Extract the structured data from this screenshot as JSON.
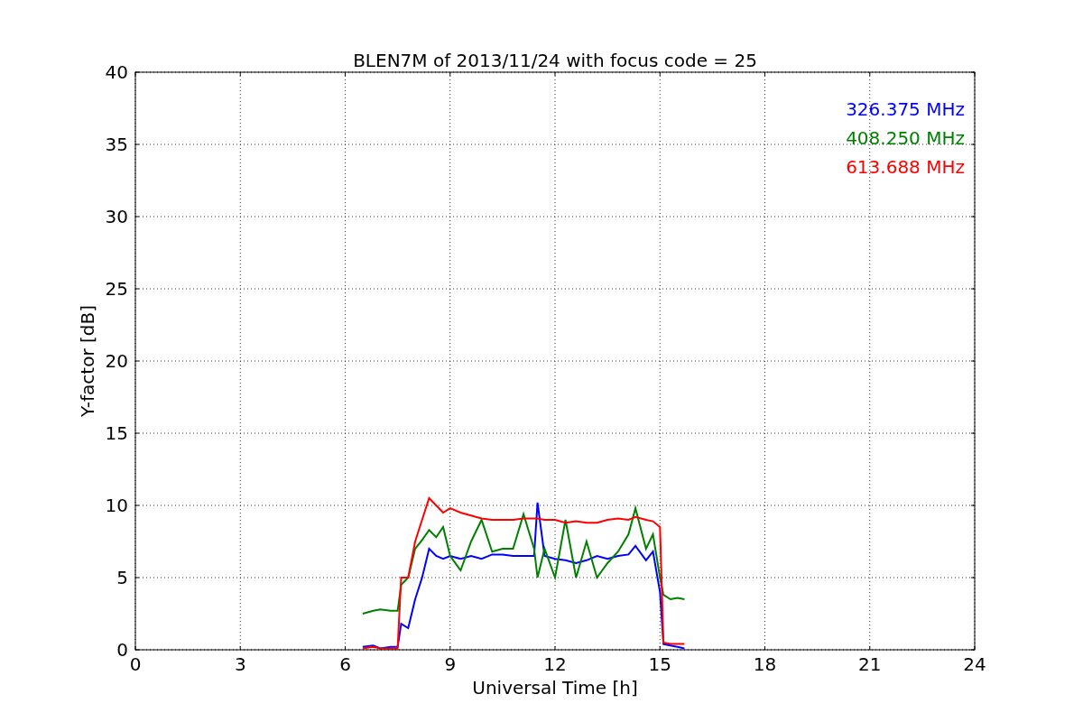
{
  "chart": {
    "chart_data": {
      "type": "line",
      "title": "BLEN7M of 2013/11/24 with focus code = 25",
      "xlabel": "Universal Time [h]",
      "ylabel": "Y-factor [dB]",
      "xlim": [
        0,
        24
      ],
      "ylim": [
        0,
        40
      ],
      "xticks": [
        0,
        3,
        6,
        9,
        12,
        15,
        18,
        21,
        24
      ],
      "yticks": [
        0,
        5,
        10,
        15,
        20,
        25,
        30,
        35,
        40
      ],
      "grid": true,
      "x": [
        6.5,
        6.8,
        7.0,
        7.3,
        7.5,
        7.6,
        7.8,
        8.0,
        8.2,
        8.4,
        8.6,
        8.8,
        9.0,
        9.3,
        9.6,
        9.9,
        10.2,
        10.5,
        10.8,
        11.1,
        11.4,
        11.5,
        11.7,
        12.0,
        12.3,
        12.6,
        12.9,
        13.2,
        13.5,
        13.8,
        14.1,
        14.3,
        14.6,
        14.8,
        15.0,
        15.1,
        15.3,
        15.5,
        15.7
      ],
      "series": [
        {
          "name": "326.375 MHz",
          "color": "#0000ff",
          "values": [
            0.2,
            0.3,
            0.1,
            0.2,
            0.2,
            1.8,
            1.5,
            3.5,
            5,
            7,
            6.5,
            6.3,
            6.5,
            6.3,
            6.5,
            6.3,
            6.6,
            6.6,
            6.5,
            6.5,
            6.5,
            10.2,
            6.5,
            6.3,
            6.2,
            6,
            6.2,
            6.5,
            6.3,
            6.5,
            6.6,
            7.2,
            6.2,
            6.8,
            4,
            0.4,
            0.3,
            0.2,
            0.1
          ]
        },
        {
          "name": "408.250 MHz",
          "color": "#008000",
          "values": [
            2.5,
            2.7,
            2.8,
            2.7,
            2.7,
            4.5,
            5,
            7,
            7.6,
            8.3,
            7.8,
            8.5,
            6.5,
            5.5,
            7.5,
            9,
            6.8,
            7,
            7,
            9.4,
            7,
            5,
            7,
            5,
            9,
            5,
            7.5,
            5,
            6,
            6.8,
            8,
            9.8,
            7,
            8,
            5,
            3.8,
            3.5,
            3.6,
            3.5
          ]
        },
        {
          "name": "613.688 MHz",
          "color": "#ff0000",
          "values": [
            0.1,
            0.2,
            0.1,
            0.1,
            0.1,
            5,
            5,
            7.5,
            9,
            10.5,
            10,
            9.5,
            9.8,
            9.5,
            9.3,
            9.1,
            9,
            9,
            9,
            9.1,
            9.1,
            9.1,
            9,
            9,
            8.8,
            8.9,
            8.8,
            8.8,
            9,
            9.1,
            9,
            9.2,
            9,
            8.9,
            8.5,
            0.5,
            0.4,
            0.4,
            0.4
          ]
        }
      ]
    }
  }
}
